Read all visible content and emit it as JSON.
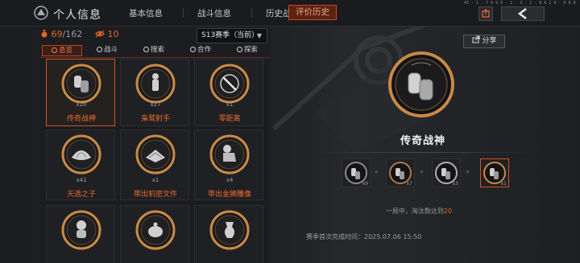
{
  "header": {
    "title": "个人信息",
    "tabs": [
      {
        "label": "基本信息"
      },
      {
        "label": "战斗信息"
      },
      {
        "label": "历史战绩"
      },
      {
        "label": "评价历史"
      }
    ],
    "server_info": "43 · 1 · 7 8 9 0 · 1 · 3 · 1 · 8 6 2 9 · 9 8 8"
  },
  "stats": {
    "collected": "69",
    "total": "/162",
    "eye_count": "10",
    "season": "S13赛季（当前）"
  },
  "filters": [
    {
      "label": "总览"
    },
    {
      "label": "战斗"
    },
    {
      "label": "搜索"
    },
    {
      "label": "合作"
    },
    {
      "label": "探索"
    }
  ],
  "badges": [
    {
      "name": "传奇战神",
      "count": "x20"
    },
    {
      "name": "枭鹫射手",
      "count": "x27"
    },
    {
      "name": "零距离",
      "count": "x1"
    },
    {
      "name": "天选之子",
      "count": "x41"
    },
    {
      "name": "带出机密文件",
      "count": "x1"
    },
    {
      "name": "带出金狮雕像",
      "count": "x4"
    }
  ],
  "detail": {
    "share": "分享",
    "title": "传奇战神",
    "tiers": [
      {
        "count": "x9"
      },
      {
        "count": "x7"
      },
      {
        "count": "x3"
      },
      {
        "count": "x1"
      }
    ],
    "note_prefix": "一局中，淘汰数达到",
    "note_value": "20",
    "first_time": "赛季首次完成时间：2025.07.06 15:50"
  },
  "colors": {
    "accent": "#e4642a",
    "accent_border": "#c9461e",
    "medal_ring": "#c98a45"
  }
}
